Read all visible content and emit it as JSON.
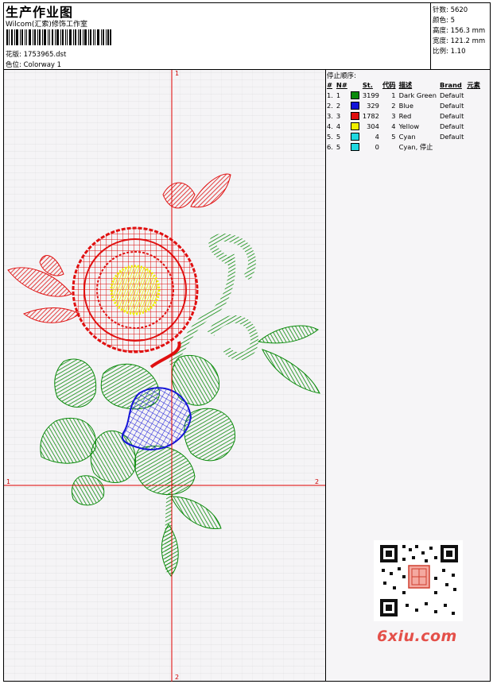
{
  "header": {
    "title": "生产作业图",
    "company": "Wilcom(汇索)修饰工作室",
    "design_label": "花版: 1753965.dst",
    "colorway_label": "色位: Colorway 1"
  },
  "stats": {
    "stitches": "针数: 5620",
    "colors": "颜色: 5",
    "height": "高度: 156.3 mm",
    "width": "宽度: 121.2 mm",
    "scale": "比例: 1.10"
  },
  "stop_sequence": {
    "title": "停止顺序:",
    "columns": [
      "#",
      "N#",
      "St.",
      "代码",
      "描述",
      "Brand",
      "元素"
    ],
    "rows": [
      {
        "idx": "1.",
        "n": "1",
        "color": "#0a8a0a",
        "st": "3199",
        "code": "1",
        "desc": "Dark Green",
        "brand": "Default"
      },
      {
        "idx": "2.",
        "n": "2",
        "color": "#1414d8",
        "st": "329",
        "code": "2",
        "desc": "Blue",
        "brand": "Default"
      },
      {
        "idx": "3.",
        "n": "3",
        "color": "#e01010",
        "st": "1782",
        "code": "3",
        "desc": "Red",
        "brand": "Default"
      },
      {
        "idx": "4.",
        "n": "4",
        "color": "#f0f000",
        "st": "304",
        "code": "4",
        "desc": "Yellow",
        "brand": "Default"
      },
      {
        "idx": "5.",
        "n": "5",
        "color": "#20d8e0",
        "st": "4",
        "code": "5",
        "desc": "Cyan",
        "brand": "Default"
      },
      {
        "idx": "6.",
        "n": "5",
        "color": "#20d8e0",
        "st": "0",
        "code": "",
        "desc": "Cyan, 停止",
        "brand": ""
      }
    ]
  },
  "axes": {
    "top": "1",
    "bottom": "2",
    "left": "1",
    "right": "2"
  },
  "watermark": {
    "logo": "6xiu.com"
  },
  "colors": {
    "guide": "#e00000",
    "green": "#0a8a0a",
    "red": "#e01010",
    "blue": "#1414d8",
    "yellow": "#f0f000"
  }
}
